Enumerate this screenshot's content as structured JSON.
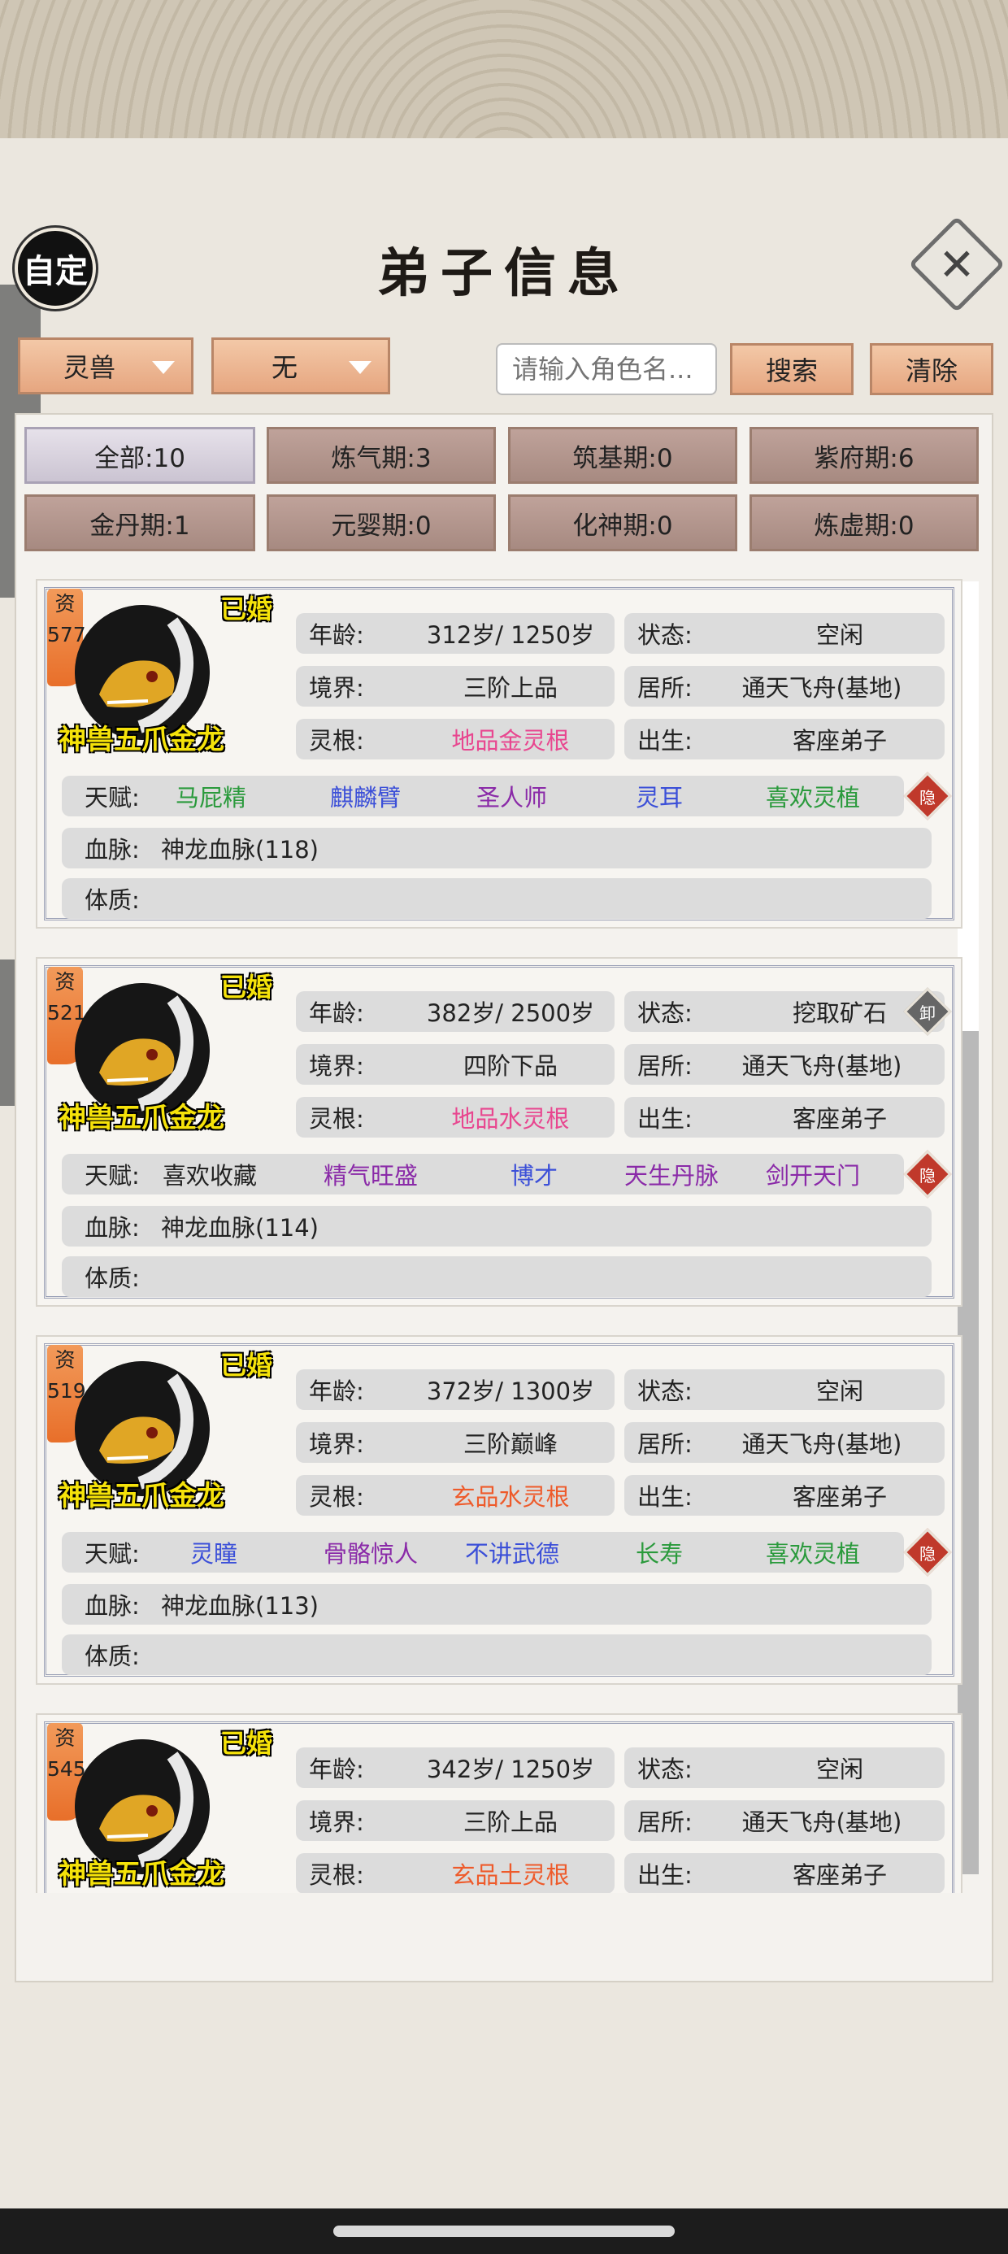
{
  "header": {
    "title": "弟子信息",
    "auto_label": "自定"
  },
  "filters": {
    "type_dropdown": "灵兽",
    "sub_dropdown": "无",
    "search_placeholder": "请输入角色名...",
    "search_button": "搜索",
    "clear_button": "清除"
  },
  "realm_tabs": [
    "全部:10",
    "炼气期:3",
    "筑基期:0",
    "紫府期:6",
    "金丹期:1",
    "元婴期:0",
    "化神期:0",
    "炼虚期:0"
  ],
  "labels": {
    "age": "年龄:",
    "status": "状态:",
    "realm": "境界:",
    "residence": "居所:",
    "root": "灵根:",
    "origin": "出生:",
    "talent": "天赋:",
    "bloodline": "血脉:",
    "physique": "体质:",
    "zi": "资",
    "hide": "隐",
    "unload": "卸"
  },
  "disciples": [
    {
      "zi_value": "577",
      "married": "已婚",
      "name": "神兽五爪金龙",
      "age": "312岁/ 1250岁",
      "status": "空闲",
      "realm": "三阶上品",
      "residence": "通天飞舟(基地)",
      "root": "地品金灵根",
      "root_color": "#e8468f",
      "origin": "客座弟子",
      "talents": [
        {
          "text": "马屁精",
          "color": "#2a9a3c"
        },
        {
          "text": "麒麟臂",
          "color": "#3b4fd8"
        },
        {
          "text": "圣人师",
          "color": "#8a2aa8"
        },
        {
          "text": "灵耳",
          "color": "#3b4fd8"
        },
        {
          "text": "喜欢灵植",
          "color": "#2a9a3c"
        }
      ],
      "bloodline": "神龙血脉(118)",
      "physique": "",
      "unload": false
    },
    {
      "zi_value": "521",
      "married": "已婚",
      "name": "神兽五爪金龙",
      "age": "382岁/ 2500岁",
      "status": "挖取矿石",
      "realm": "四阶下品",
      "residence": "通天飞舟(基地)",
      "root": "地品水灵根",
      "root_color": "#e8468f",
      "origin": "客座弟子",
      "talents": [
        {
          "text": "喜欢收藏",
          "color": "#222222"
        },
        {
          "text": "精气旺盛",
          "color": "#8a2aa8"
        },
        {
          "text": "博才",
          "color": "#3b4fd8"
        },
        {
          "text": "天生丹脉",
          "color": "#8a2aa8"
        },
        {
          "text": "剑开天门",
          "color": "#8a2aa8"
        }
      ],
      "bloodline": "神龙血脉(114)",
      "physique": "",
      "unload": true
    },
    {
      "zi_value": "519",
      "married": "已婚",
      "name": "神兽五爪金龙",
      "age": "372岁/ 1300岁",
      "status": "空闲",
      "realm": "三阶巅峰",
      "residence": "通天飞舟(基地)",
      "root": "玄品水灵根",
      "root_color": "#ee5a2a",
      "origin": "客座弟子",
      "talents": [
        {
          "text": "灵瞳",
          "color": "#3b4fd8"
        },
        {
          "text": "骨骼惊人",
          "color": "#8a2aa8"
        },
        {
          "text": "不讲武德",
          "color": "#3b4fd8"
        },
        {
          "text": "长寿",
          "color": "#2a9a3c"
        },
        {
          "text": "喜欢灵植",
          "color": "#2a9a3c"
        }
      ],
      "bloodline": "神龙血脉(113)",
      "physique": "",
      "unload": false
    },
    {
      "zi_value": "545",
      "married": "已婚",
      "name": "神兽五爪金龙",
      "age": "342岁/ 1250岁",
      "status": "空闲",
      "realm": "三阶上品",
      "residence": "通天飞舟(基地)",
      "root": "玄品土灵根",
      "root_color": "#ee5a2a",
      "origin": "客座弟子",
      "talents": [],
      "bloodline": "",
      "physique": "",
      "unload": false
    }
  ],
  "colors": {
    "accent_button": "#e6a680",
    "hide_badge": "#c0392b",
    "unload_badge": "#666666",
    "pet_name": "#f5e20a"
  }
}
